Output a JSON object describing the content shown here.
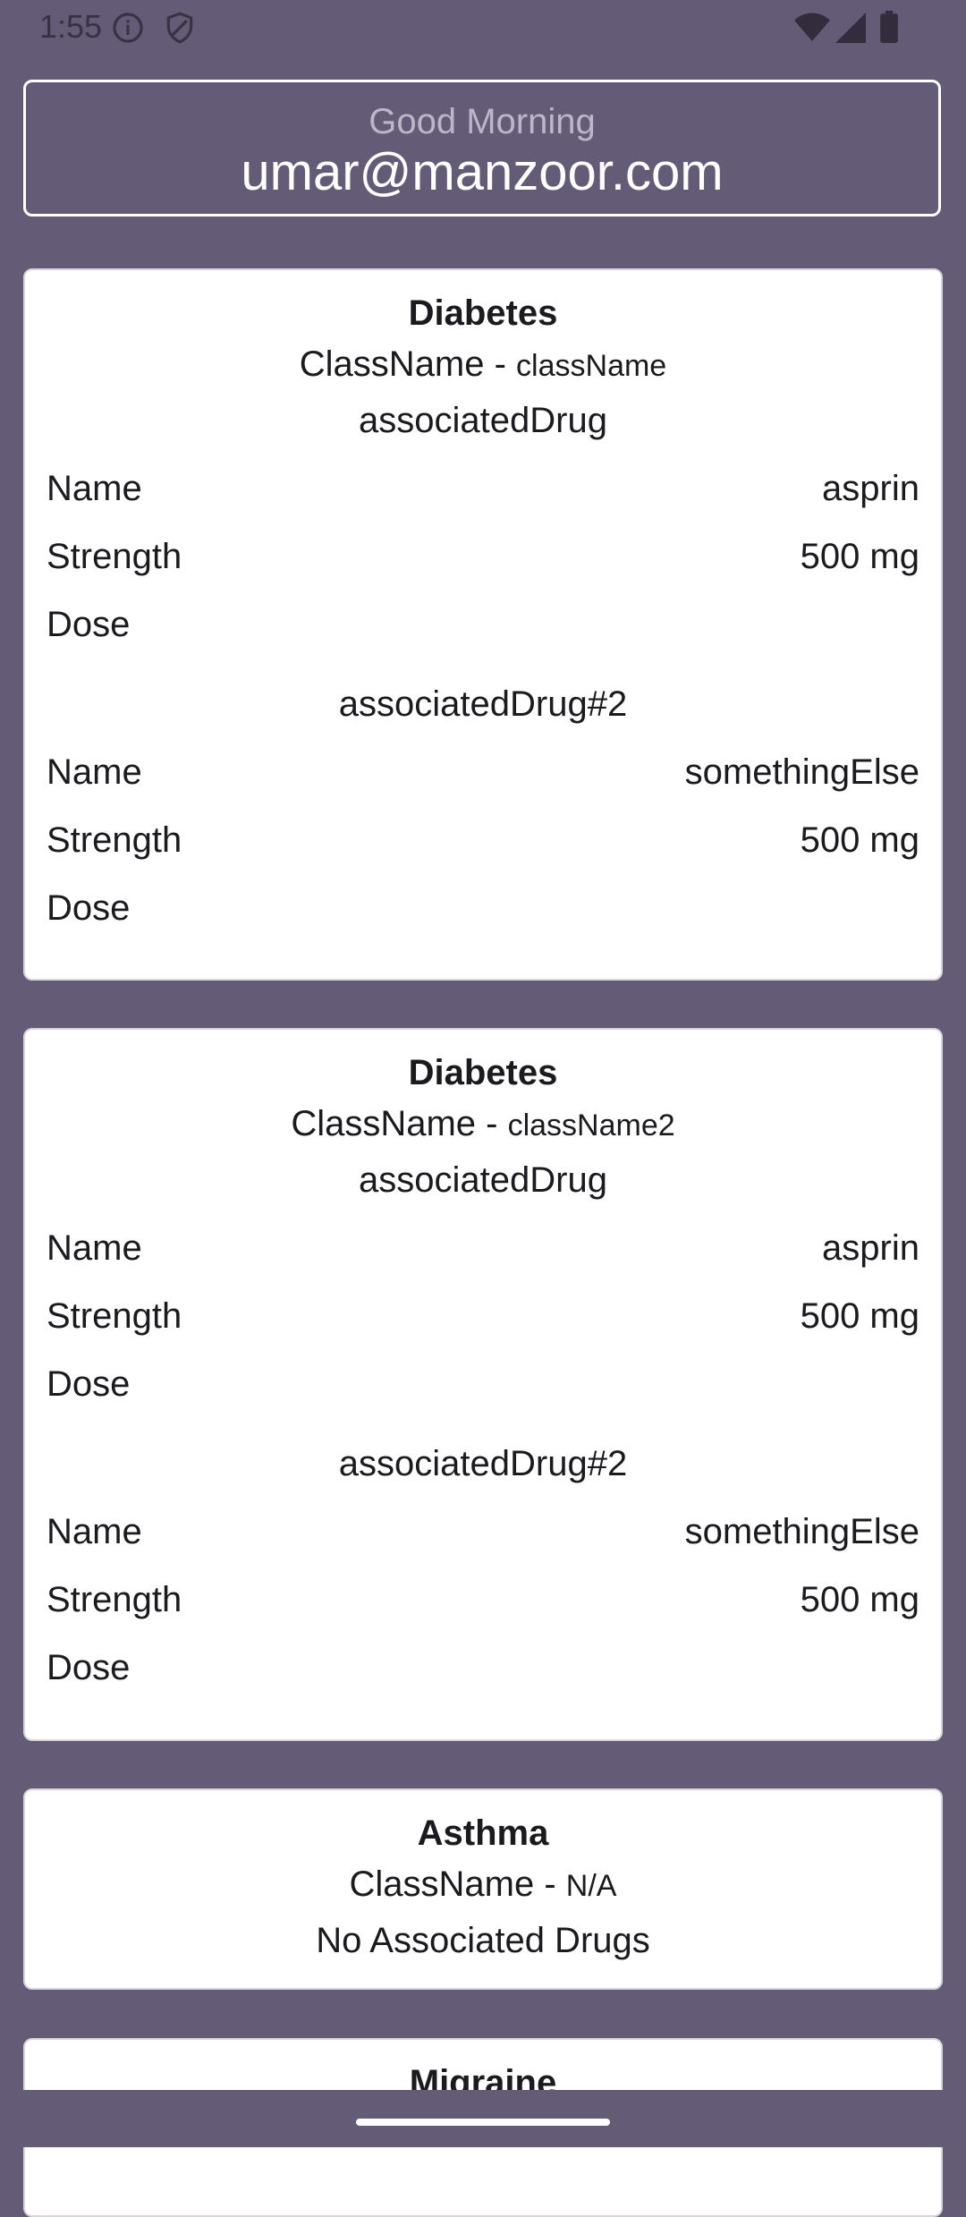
{
  "status_bar": {
    "time": "1:55",
    "icons": [
      "info-icon",
      "shield-icon",
      "wifi-icon",
      "signal-icon",
      "battery-icon"
    ]
  },
  "header": {
    "greeting": "Good Morning",
    "email": "umar@manzoor.com"
  },
  "labels": {
    "class_prefix": "ClassName - ",
    "name": "Name",
    "strength": "Strength",
    "dose": "Dose",
    "no_drugs": "No Associated Drugs"
  },
  "cards": [
    {
      "title": "Diabetes",
      "class_name": "className",
      "drugs": [
        {
          "heading": "associatedDrug",
          "name": "asprin",
          "strength": "500 mg",
          "dose": ""
        },
        {
          "heading": "associatedDrug#2",
          "name": "somethingElse",
          "strength": "500 mg",
          "dose": ""
        }
      ]
    },
    {
      "title": "Diabetes",
      "class_name": "className2",
      "drugs": [
        {
          "heading": "associatedDrug",
          "name": "asprin",
          "strength": "500 mg",
          "dose": ""
        },
        {
          "heading": "associatedDrug#2",
          "name": "somethingElse",
          "strength": "500 mg",
          "dose": ""
        }
      ]
    },
    {
      "title": "Asthma",
      "class_name": "N/A",
      "drugs": []
    },
    {
      "title": "Migraine"
    }
  ],
  "colors": {
    "background": "#645b76",
    "card": "#ffffff",
    "greeting": "#bdb6c9",
    "text": "#1b1b1f"
  }
}
